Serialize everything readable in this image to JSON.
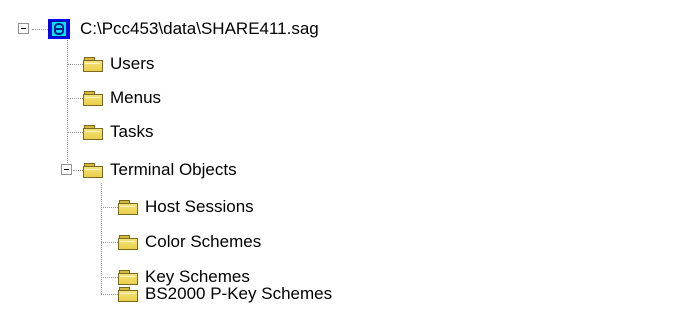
{
  "tree": {
    "root": {
      "label": "C:\\Pcc453\\data\\SHARE411.sag",
      "icon": "database-icon",
      "expanded": true
    },
    "children": [
      {
        "label": "Users",
        "icon": "folder-icon"
      },
      {
        "label": "Menus",
        "icon": "folder-icon"
      },
      {
        "label": "Tasks",
        "icon": "folder-icon"
      },
      {
        "label": "Terminal Objects",
        "icon": "folder-icon",
        "expanded": true,
        "children": [
          {
            "label": "Host Sessions",
            "icon": "folder-icon"
          },
          {
            "label": "Color Schemes",
            "icon": "folder-icon"
          },
          {
            "label": "Key Schemes",
            "icon": "folder-icon"
          },
          {
            "label": "BS2000 P-Key Schemes",
            "icon": "folder-icon"
          }
        ]
      }
    ]
  },
  "colors": {
    "background": "#ffffff",
    "text": "#000000",
    "guide_lines": "#9a9a9a",
    "folder": "#f6e27a",
    "root_icon_bg": "#0000ff",
    "root_icon_fill": "#00e5ff"
  }
}
